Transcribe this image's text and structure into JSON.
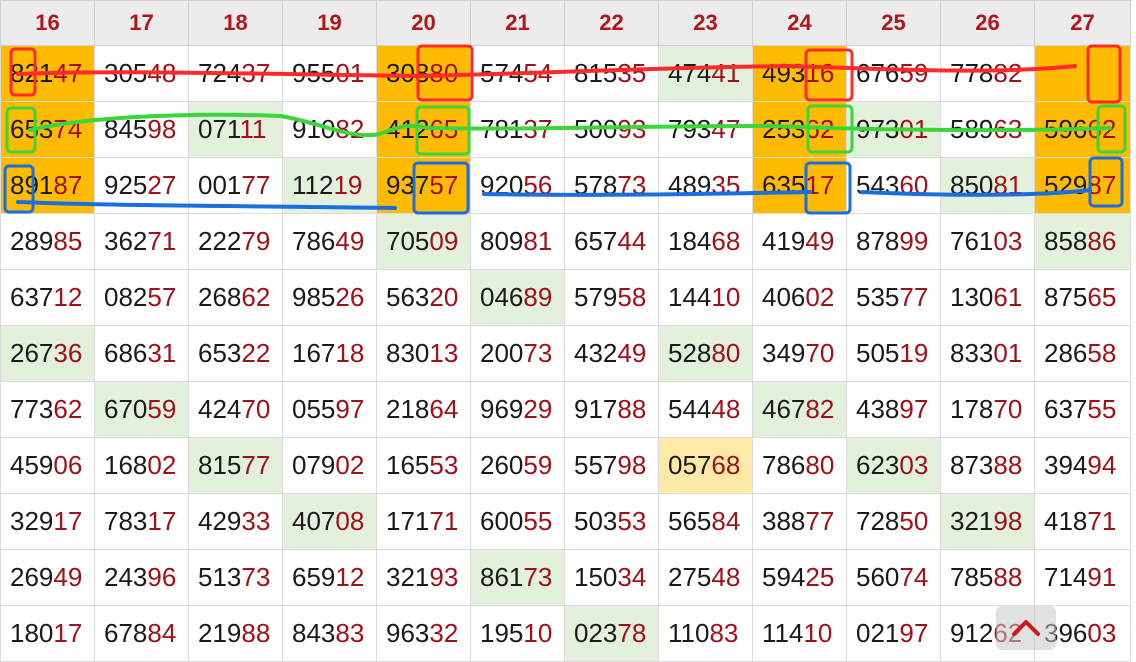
{
  "columns": [
    "16",
    "17",
    "18",
    "19",
    "20",
    "21",
    "22",
    "23",
    "24",
    "25",
    "26",
    "27"
  ],
  "rows": [
    [
      {
        "v": "82147",
        "bg": "orange"
      },
      {
        "v": "30548"
      },
      {
        "v": "72437"
      },
      {
        "v": "95501"
      },
      {
        "v": "30880",
        "bg": "orange"
      },
      {
        "v": "57454"
      },
      {
        "v": "81535"
      },
      {
        "v": "47441",
        "bg": "green"
      },
      {
        "v": "49316",
        "bg": "orange"
      },
      {
        "v": "67659"
      },
      {
        "v": "77882"
      },
      {
        "v": "",
        "bg": "orange"
      }
    ],
    [
      {
        "v": "65374",
        "bg": "orange"
      },
      {
        "v": "84598"
      },
      {
        "v": "07111",
        "bg": "green"
      },
      {
        "v": "91082"
      },
      {
        "v": "41265",
        "bg": "orange"
      },
      {
        "v": "78137"
      },
      {
        "v": "50093"
      },
      {
        "v": "79347"
      },
      {
        "v": "25362",
        "bg": "orange"
      },
      {
        "v": "97301",
        "bg": "green"
      },
      {
        "v": "58963"
      },
      {
        "v": "59662",
        "bg": "orange"
      }
    ],
    [
      {
        "v": "89187",
        "bg": "orange"
      },
      {
        "v": "92527"
      },
      {
        "v": "00177"
      },
      {
        "v": "11219",
        "bg": "green"
      },
      {
        "v": "93757",
        "bg": "orange"
      },
      {
        "v": "92056"
      },
      {
        "v": "57873"
      },
      {
        "v": "48935"
      },
      {
        "v": "63517",
        "bg": "orange"
      },
      {
        "v": "54360"
      },
      {
        "v": "85081",
        "bg": "green"
      },
      {
        "v": "52987",
        "bg": "orange"
      }
    ],
    [
      {
        "v": "28985"
      },
      {
        "v": "36271"
      },
      {
        "v": "22279"
      },
      {
        "v": "78649"
      },
      {
        "v": "70509",
        "bg": "green"
      },
      {
        "v": "80981"
      },
      {
        "v": "65744"
      },
      {
        "v": "18468"
      },
      {
        "v": "41949"
      },
      {
        "v": "87899"
      },
      {
        "v": "76103"
      },
      {
        "v": "85886",
        "bg": "green"
      }
    ],
    [
      {
        "v": "63712"
      },
      {
        "v": "08257"
      },
      {
        "v": "26862"
      },
      {
        "v": "98526"
      },
      {
        "v": "56320"
      },
      {
        "v": "04689",
        "bg": "green"
      },
      {
        "v": "57958"
      },
      {
        "v": "14410"
      },
      {
        "v": "40602"
      },
      {
        "v": "53577"
      },
      {
        "v": "13061"
      },
      {
        "v": "87565"
      }
    ],
    [
      {
        "v": "26736",
        "bg": "green"
      },
      {
        "v": "68631"
      },
      {
        "v": "65322"
      },
      {
        "v": "16718"
      },
      {
        "v": "83013"
      },
      {
        "v": "20073"
      },
      {
        "v": "43249"
      },
      {
        "v": "52880",
        "bg": "green"
      },
      {
        "v": "34970"
      },
      {
        "v": "50519"
      },
      {
        "v": "83301"
      },
      {
        "v": "28658"
      }
    ],
    [
      {
        "v": "77362"
      },
      {
        "v": "67059",
        "bg": "green"
      },
      {
        "v": "42470"
      },
      {
        "v": "05597"
      },
      {
        "v": "21864"
      },
      {
        "v": "96929"
      },
      {
        "v": "91788"
      },
      {
        "v": "54448"
      },
      {
        "v": "46782",
        "bg": "green"
      },
      {
        "v": "43897"
      },
      {
        "v": "17870"
      },
      {
        "v": "63755"
      }
    ],
    [
      {
        "v": "45906"
      },
      {
        "v": "16802"
      },
      {
        "v": "81577",
        "bg": "green"
      },
      {
        "v": "07902"
      },
      {
        "v": "16553"
      },
      {
        "v": "26059"
      },
      {
        "v": "55798"
      },
      {
        "v": "05768",
        "bg": "yellow"
      },
      {
        "v": "78680"
      },
      {
        "v": "62303",
        "bg": "green"
      },
      {
        "v": "87388"
      },
      {
        "v": "39494"
      }
    ],
    [
      {
        "v": "32917"
      },
      {
        "v": "78317"
      },
      {
        "v": "42933"
      },
      {
        "v": "40708",
        "bg": "green"
      },
      {
        "v": "17171"
      },
      {
        "v": "60055"
      },
      {
        "v": "50353"
      },
      {
        "v": "56584"
      },
      {
        "v": "38877"
      },
      {
        "v": "72850"
      },
      {
        "v": "32198",
        "bg": "green"
      },
      {
        "v": "41871"
      }
    ],
    [
      {
        "v": "26949"
      },
      {
        "v": "24396"
      },
      {
        "v": "51373"
      },
      {
        "v": "65912"
      },
      {
        "v": "32193"
      },
      {
        "v": "86173",
        "bg": "green"
      },
      {
        "v": "15034"
      },
      {
        "v": "27548"
      },
      {
        "v": "59425"
      },
      {
        "v": "56074"
      },
      {
        "v": "78588"
      },
      {
        "v": "71491"
      }
    ],
    [
      {
        "v": "18017"
      },
      {
        "v": "67884"
      },
      {
        "v": "21988"
      },
      {
        "v": "84383"
      },
      {
        "v": "96332"
      },
      {
        "v": "19510"
      },
      {
        "v": "02378",
        "bg": "green"
      },
      {
        "v": "11083"
      },
      {
        "v": "11410"
      },
      {
        "v": "02197"
      },
      {
        "v": "91262"
      },
      {
        "v": "39603"
      }
    ]
  ],
  "colors": {
    "header_text": "#b0161a",
    "digit_highlight": "#a0101a",
    "cell_orange": "#ffbb00",
    "cell_green": "#e3f1dc",
    "cell_yellow": "#ffe9a6",
    "annotation_red": "#ff2a2a",
    "annotation_green": "#3ad63a",
    "annotation_blue": "#1a6fe0"
  },
  "icons": {
    "scroll_top_button": "chevron-up-icon"
  }
}
